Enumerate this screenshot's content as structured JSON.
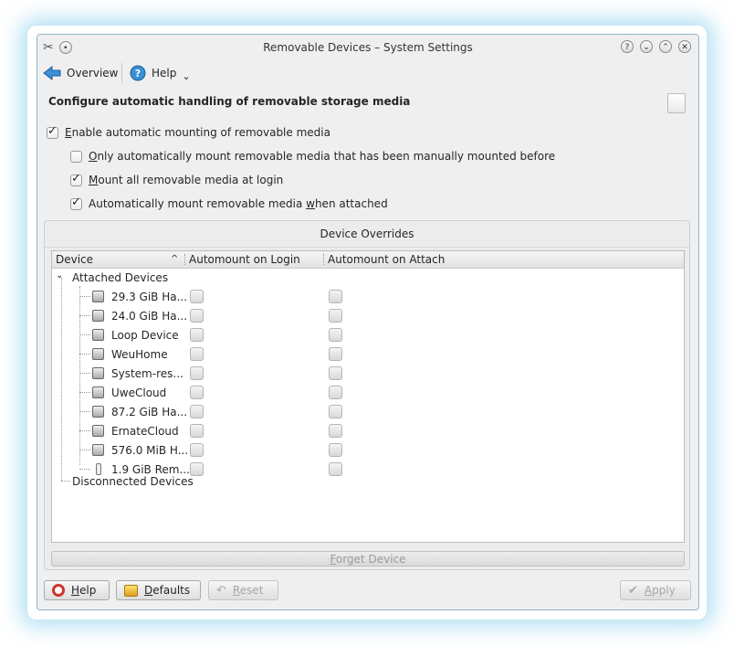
{
  "window": {
    "title": "Removable Devices – System Settings"
  },
  "toolbar": {
    "overview_label": "Overview",
    "help_label": "Help",
    "help_dropdown_glyph": "⌄"
  },
  "heading": "Configure automatic handling of removable storage media",
  "options": {
    "enable_auto": {
      "label_u": "E",
      "label_rest": "nable automatic mounting of removable media",
      "checked": true
    },
    "only_manual": {
      "label_u": "O",
      "label_rest": "nly automatically mount removable media that has been manually mounted before",
      "checked": false
    },
    "mount_login": {
      "label_u": "M",
      "label_rest": "ount all removable media at login",
      "checked": true
    },
    "mount_attach": {
      "label_pre": "Automatically mount removable media ",
      "label_u": "w",
      "label_post": "hen attached",
      "checked": true
    }
  },
  "overrides": {
    "title": "Device Overrides",
    "columns": {
      "device": "Device",
      "login": "Automount on Login",
      "attach": "Automount on Attach",
      "sort_glyph": "^"
    },
    "attached_label": "Attached Devices",
    "expand_glyph": "⌄",
    "disconnected_label": "Disconnected Devices",
    "devices": [
      {
        "name": "29.3 GiB Ha...",
        "icon": "hard-disk-icon"
      },
      {
        "name": "24.0 GiB Ha...",
        "icon": "hard-disk-icon"
      },
      {
        "name": "Loop Device",
        "icon": "hard-disk-icon"
      },
      {
        "name": "WeuHome",
        "icon": "hard-disk-icon"
      },
      {
        "name": "System-res...",
        "icon": "hard-disk-icon"
      },
      {
        "name": "UweCloud",
        "icon": "hard-disk-icon"
      },
      {
        "name": "87.2 GiB Ha...",
        "icon": "hard-disk-icon"
      },
      {
        "name": "ErnateCloud",
        "icon": "hard-disk-icon"
      },
      {
        "name": "576.0 MiB H...",
        "icon": "hard-disk-icon"
      },
      {
        "name": "1.9 GiB Rem...",
        "icon": "usb-drive-icon"
      }
    ],
    "forget_u": "F",
    "forget_rest": "orget Device"
  },
  "buttons": {
    "help": {
      "u": "H",
      "rest": "elp"
    },
    "defaults": {
      "u": "D",
      "rest": "efaults"
    },
    "reset": {
      "u": "R",
      "rest": "eset"
    },
    "apply": {
      "u": "A",
      "rest": "pply"
    }
  },
  "colors": {
    "accent": "#3daee9",
    "window_bg": "#efefef"
  }
}
